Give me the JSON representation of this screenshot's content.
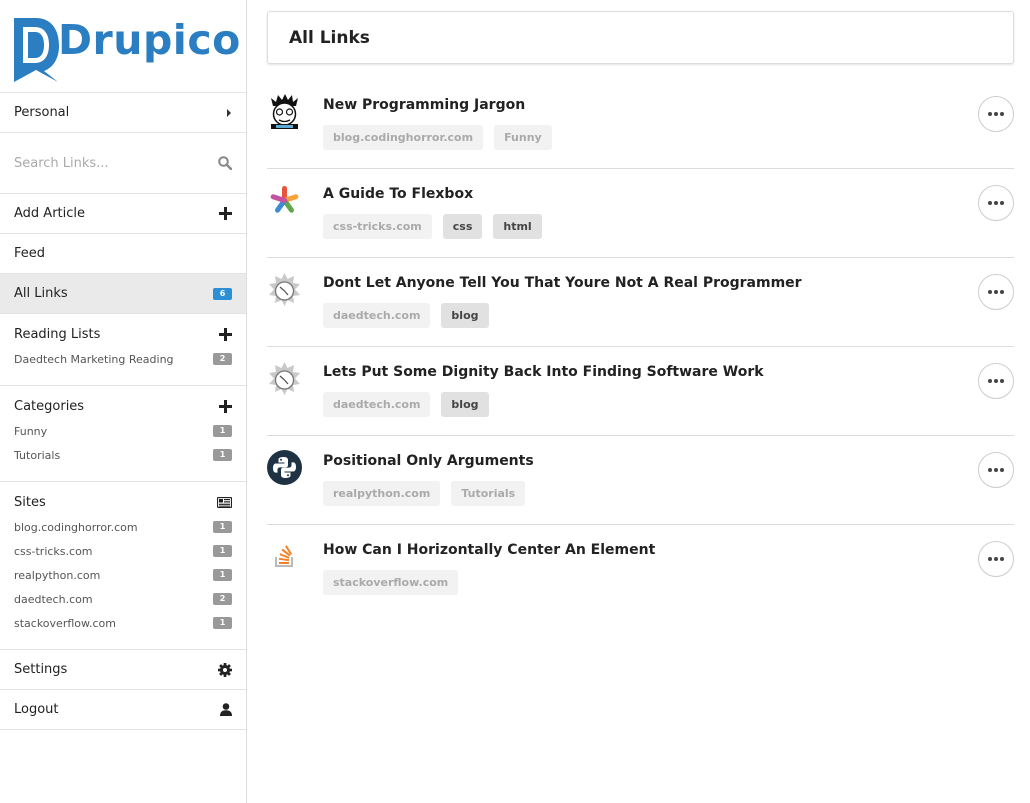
{
  "brand": {
    "name": "Drupico",
    "color": "#2b7ec1"
  },
  "sidebar": {
    "personal": "Personal",
    "search_placeholder": "Search Links...",
    "add_article": "Add Article",
    "feed": "Feed",
    "all_links": {
      "label": "All Links",
      "count": "6"
    },
    "reading_lists": {
      "label": "Reading Lists",
      "items": [
        {
          "label": "Daedtech Marketing Reading",
          "count": "2"
        }
      ]
    },
    "categories": {
      "label": "Categories",
      "items": [
        {
          "label": "Funny",
          "count": "1"
        },
        {
          "label": "Tutorials",
          "count": "1"
        }
      ]
    },
    "sites": {
      "label": "Sites",
      "items": [
        {
          "label": "blog.codinghorror.com",
          "count": "1"
        },
        {
          "label": "css-tricks.com",
          "count": "1"
        },
        {
          "label": "realpython.com",
          "count": "1"
        },
        {
          "label": "daedtech.com",
          "count": "2"
        },
        {
          "label": "stackoverflow.com",
          "count": "1"
        }
      ]
    },
    "settings": "Settings",
    "logout": "Logout"
  },
  "main": {
    "title": "All Links",
    "links": [
      {
        "title": "New Programming Jargon",
        "icon": "coding-horror-icon",
        "site": "blog.codinghorror.com",
        "tags": [
          {
            "label": "Funny",
            "dark": false
          }
        ]
      },
      {
        "title": "A Guide To Flexbox",
        "icon": "css-tricks-icon",
        "site": "css-tricks.com",
        "tags": [
          {
            "label": "css",
            "dark": true
          },
          {
            "label": "html",
            "dark": true
          }
        ]
      },
      {
        "title": "Dont Let Anyone Tell You That Youre Not A Real Programmer",
        "icon": "daedtech-icon",
        "site": "daedtech.com",
        "tags": [
          {
            "label": "blog",
            "dark": true
          }
        ]
      },
      {
        "title": "Lets Put Some Dignity Back Into Finding Software Work",
        "icon": "daedtech-icon",
        "site": "daedtech.com",
        "tags": [
          {
            "label": "blog",
            "dark": true
          }
        ]
      },
      {
        "title": "Positional Only Arguments",
        "icon": "python-icon",
        "site": "realpython.com",
        "tags": [
          {
            "label": "Tutorials",
            "dark": false
          }
        ]
      },
      {
        "title": "How Can I Horizontally Center An Element",
        "icon": "stackoverflow-icon",
        "site": "stackoverflow.com",
        "tags": []
      }
    ]
  }
}
